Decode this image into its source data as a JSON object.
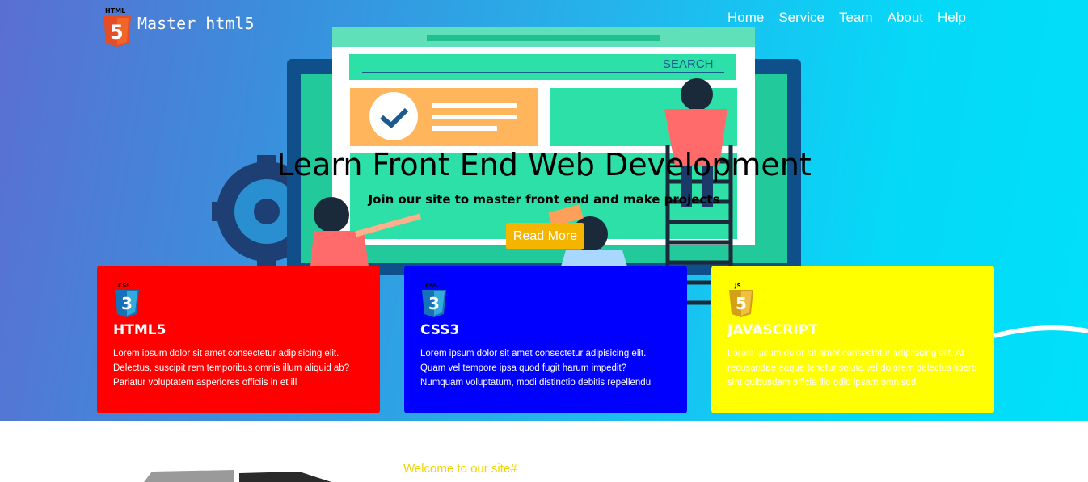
{
  "brand": {
    "name": "Master html5",
    "logo_label": "HTML",
    "logo_number": "5"
  },
  "nav": {
    "items": [
      "Home",
      "Service",
      "Team",
      "About",
      "Help"
    ]
  },
  "hero": {
    "title": "Learn Front End Web Development",
    "subtitle": "Join our site to master front end and make projects",
    "button": "Read More",
    "illustration": {
      "search_label": "SEARCH"
    }
  },
  "cards": [
    {
      "icon_label": "CSS",
      "icon_number": "3",
      "title": "HTML5",
      "text": "Lorem ipsum dolor sit amet consectetur adipisicing elit. Delectus, suscipit rem temporibus omnis illum aliquid ab? Pariatur voluptatem asperiores officiis in et ill",
      "color": "#ff0000"
    },
    {
      "icon_label": "CSS",
      "icon_number": "3",
      "title": "CSS3",
      "text": "Lorem ipsum dolor sit amet consectetur adipisicing elit. Quam vel tempore ipsa quod fugit harum impedit? Numquam voluptatum, modi distinctio debitis repellendu",
      "color": "#0000ff"
    },
    {
      "icon_label": "JS",
      "icon_number": "5",
      "title": "JAVASCRIPT",
      "text": "Lorem ipsum dolor sit amet consectetur adipisicing elit. At recusandae eaque tenetur soluta vel dolorem delectus libero sint quibusdam officia illo odio ipsam omnisdd",
      "color": "#ffff00"
    }
  ],
  "section": {
    "welcome": "Welcome to our site#"
  },
  "colors": {
    "button": "#f5b400",
    "welcome": "#f2d500"
  }
}
